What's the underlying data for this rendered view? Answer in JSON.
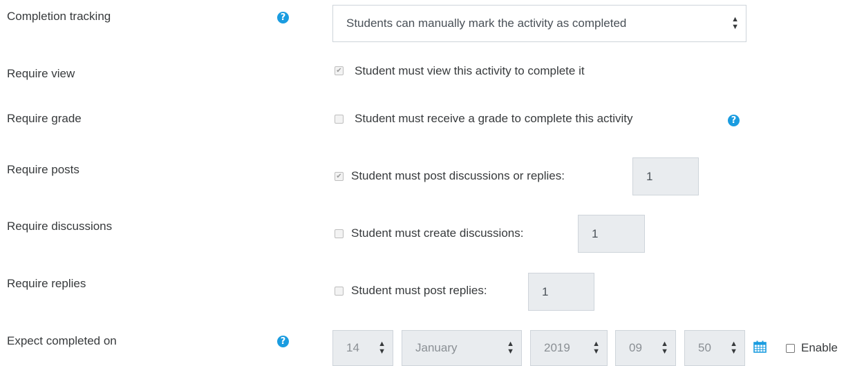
{
  "rows": {
    "completion_tracking": {
      "label": "Completion tracking",
      "select_value": "Students can manually mark the activity as completed"
    },
    "require_view": {
      "label": "Require view",
      "checkbox_label": "Student must view this activity to complete it",
      "checked": true
    },
    "require_grade": {
      "label": "Require grade",
      "checkbox_label": "Student must receive a grade to complete this activity",
      "checked": false
    },
    "require_posts": {
      "label": "Require posts",
      "checkbox_label": "Student must post discussions or replies:",
      "checked": true,
      "value": "1"
    },
    "require_discussions": {
      "label": "Require discussions",
      "checkbox_label": "Student must create discussions:",
      "checked": false,
      "value": "1"
    },
    "require_replies": {
      "label": "Require replies",
      "checkbox_label": "Student must post replies:",
      "checked": false,
      "value": "1"
    },
    "expect_completed_on": {
      "label": "Expect completed on",
      "day": "14",
      "month": "January",
      "year": "2019",
      "hour": "09",
      "minute": "50",
      "enable_label": "Enable",
      "enabled": false
    }
  },
  "icons": {
    "help": "question-circle-icon",
    "calendar": "calendar-icon",
    "select_caret": "sort-caret-icon"
  },
  "colors": {
    "help_icon": "#1a9ce0",
    "disabled_field": "#e9ecef",
    "text": "#373a3c"
  }
}
